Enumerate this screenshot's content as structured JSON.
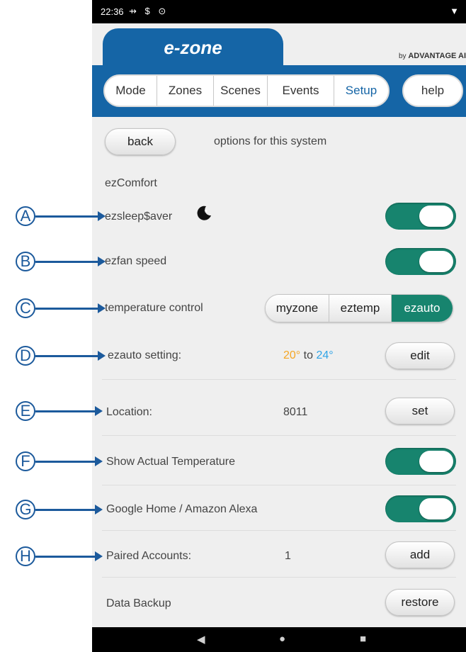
{
  "status_bar": {
    "time": "22:36",
    "icons": "⇸ $ ⊙",
    "signal": "▼"
  },
  "brand": {
    "logo": "e-zone",
    "by_prefix": "by",
    "by_company": "ADVANTAGE AI"
  },
  "nav": {
    "tabs": [
      "Mode",
      "Zones",
      "Scenes",
      "Events",
      "Setup"
    ],
    "active_tab": "Setup",
    "help_label": "help"
  },
  "page": {
    "back_label": "back",
    "subtitle": "options for this system",
    "section_title": "ezComfort"
  },
  "settings": {
    "sleep_saver": {
      "label": "ezsleep$aver",
      "icon": "moon-icon",
      "on": true
    },
    "fan_speed": {
      "label": "ezfan speed",
      "on": true
    },
    "temperature_control": {
      "label": "temperature control",
      "options": [
        "myzone",
        "eztemp",
        "ezauto"
      ],
      "selected": "ezauto"
    },
    "ezauto_setting": {
      "label": "ezauto setting:",
      "low": "20°",
      "to": "to",
      "high": "24°",
      "button": "edit"
    },
    "location": {
      "label": "Location:",
      "value": "8011",
      "button": "set"
    },
    "show_actual_temp": {
      "label": "Show Actual Temperature",
      "on": true
    },
    "google_alexa": {
      "label": "Google Home / Amazon Alexa",
      "on": true
    },
    "paired_accounts": {
      "label": "Paired Accounts:",
      "value": "1",
      "button": "add"
    },
    "data_backup": {
      "label": "Data Backup",
      "button": "restore"
    }
  },
  "callouts": [
    "A",
    "B",
    "C",
    "D",
    "E",
    "F",
    "G",
    "H"
  ],
  "colors": {
    "brand_blue": "#1565a6",
    "toggle_green": "#17846e",
    "low_temp": "#f5a623",
    "high_temp": "#2fa4e7",
    "callout_blue": "#1c5a9c"
  }
}
